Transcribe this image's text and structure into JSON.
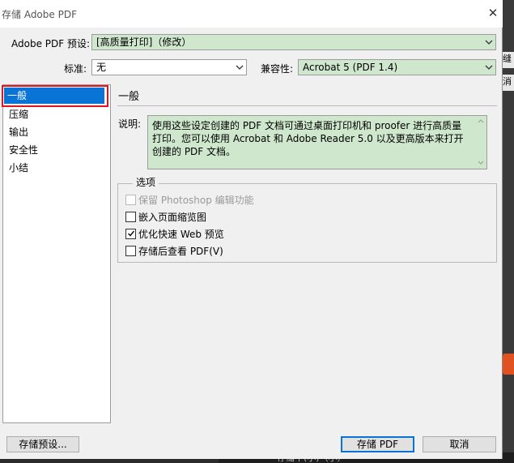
{
  "window": {
    "title": "存储 Adobe PDF",
    "close_glyph": "✕"
  },
  "preset": {
    "label": "Adobe PDF 预设:",
    "value": "[高质量打印]（修改）"
  },
  "standard": {
    "label": "标准:",
    "value": "无"
  },
  "compat": {
    "label": "兼容性:",
    "value": "Acrobat 5 (PDF 1.4)"
  },
  "sidebar": {
    "items": [
      {
        "label": "一般",
        "selected": true
      },
      {
        "label": "压缩"
      },
      {
        "label": "输出"
      },
      {
        "label": "安全性"
      },
      {
        "label": "小结"
      }
    ]
  },
  "main": {
    "section_title": "一般",
    "description_label": "说明:",
    "description": "使用这些设定创建的 PDF 文档可通过桌面打印机和 proofer 进行高质量打印。您可以使用 Acrobat 和 Adobe Reader 5.0 以及更高版本来打开创建的 PDF 文档。",
    "options_legend": "选项",
    "options": [
      {
        "label": "保留 Photoshop 编辑功能",
        "checked": false,
        "disabled": true
      },
      {
        "label": "嵌入页面缩览图",
        "checked": false,
        "disabled": false
      },
      {
        "label": "优化快速 Web 预览",
        "checked": true,
        "disabled": false
      },
      {
        "label": "存储后查看 PDF(V)",
        "checked": false,
        "disabled": false
      }
    ]
  },
  "footer": {
    "save_preset_label": "存储预设...",
    "save_pdf_label": "存储 PDF",
    "cancel_label": "取消"
  },
  "background": {
    "chip1": "缝",
    "chip2": "消",
    "bottom_text": "存储不(小)（小）"
  },
  "colors": {
    "accent": "#0a74d6",
    "field_green": "#cfe8cd",
    "highlight_red": "#e3131f"
  },
  "icons": [
    "close-icon",
    "chevron-down-icon",
    "checkmark-icon",
    "scroll-up-icon",
    "scroll-down-icon"
  ]
}
